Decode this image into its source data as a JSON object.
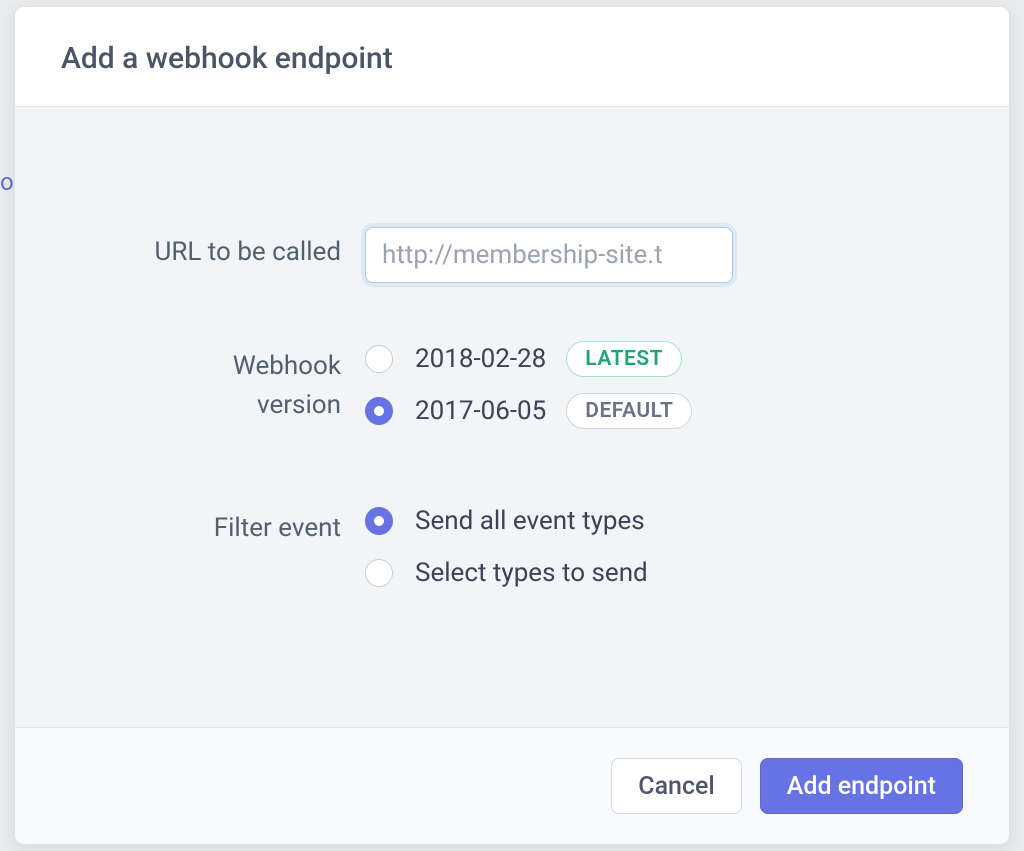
{
  "backdrop": {
    "link_fragment": "ok"
  },
  "modal": {
    "title": "Add a webhook endpoint",
    "url": {
      "label": "URL to be called",
      "placeholder": "http://membership-site.t",
      "value": ""
    },
    "version": {
      "label_line1": "Webhook",
      "label_line2": "version",
      "options": [
        {
          "value": "2018-02-28",
          "badge": "LATEST",
          "badge_type": "latest",
          "selected": false
        },
        {
          "value": "2017-06-05",
          "badge": "DEFAULT",
          "badge_type": "default",
          "selected": true
        }
      ]
    },
    "filter": {
      "label": "Filter event",
      "options": [
        {
          "value": "Send all event types",
          "selected": true
        },
        {
          "value": "Select types to send",
          "selected": false
        }
      ]
    },
    "footer": {
      "cancel": "Cancel",
      "submit": "Add endpoint"
    }
  }
}
